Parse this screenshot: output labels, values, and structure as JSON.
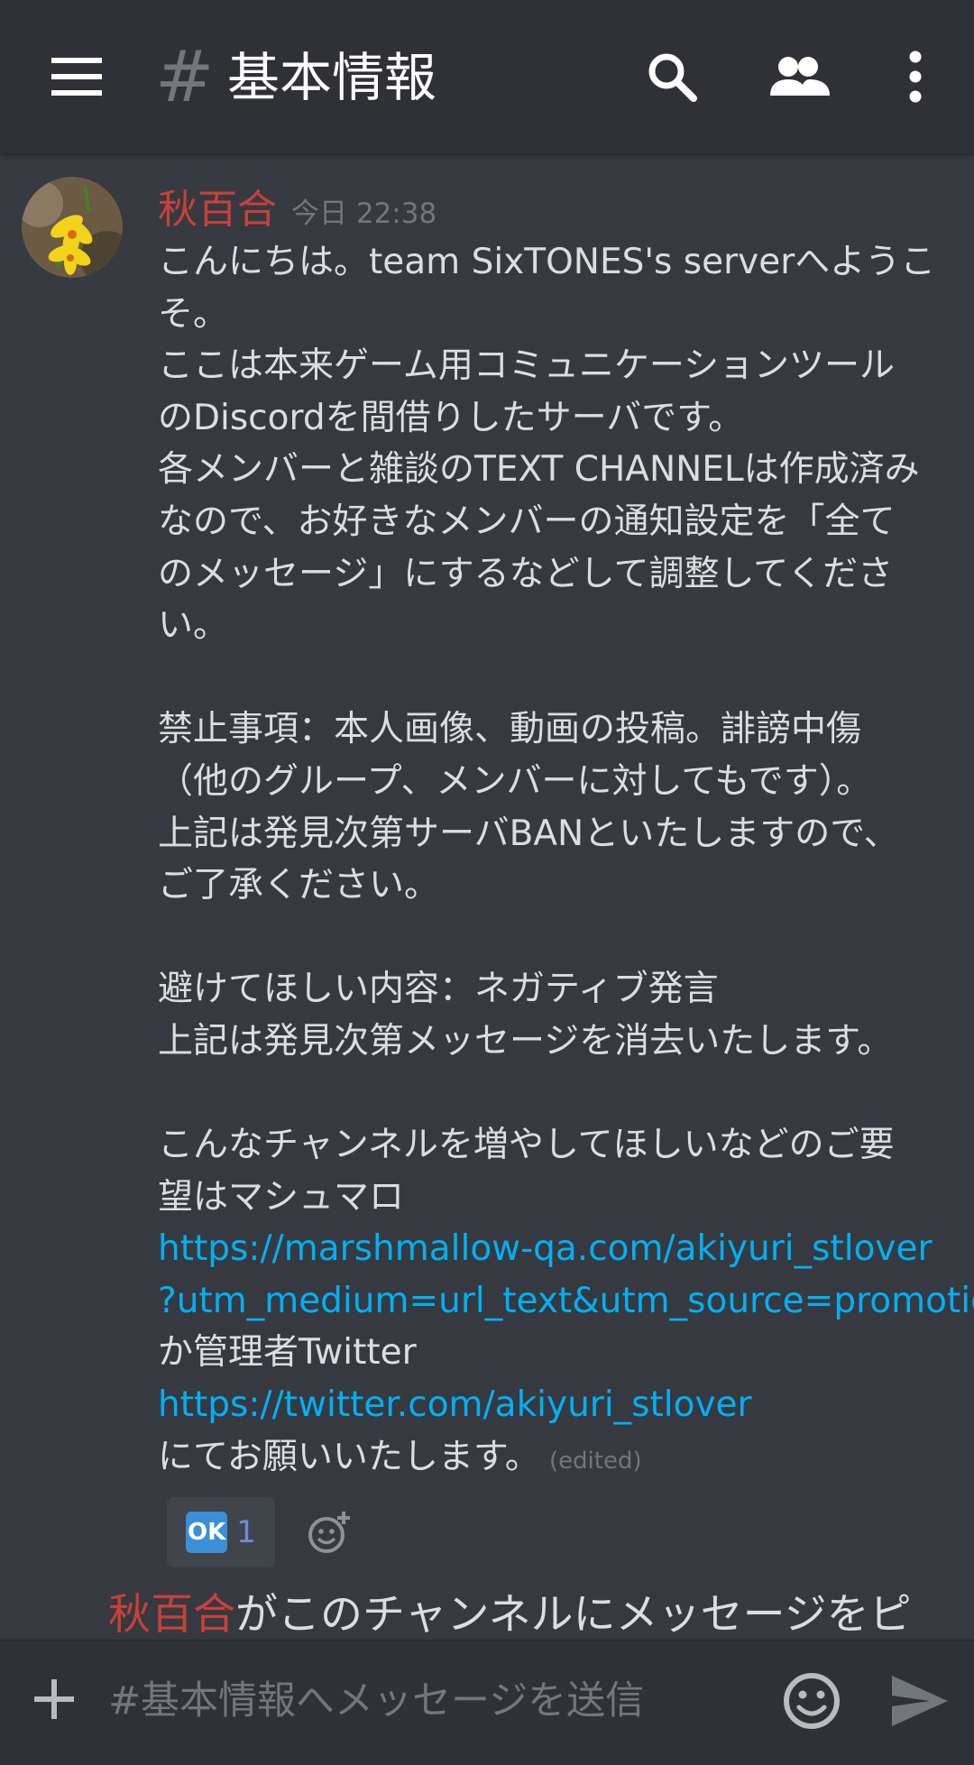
{
  "header": {
    "hash_symbol": "#",
    "channel_name": "基本情報",
    "icons": [
      "hamburger-icon",
      "search-icon",
      "members-icon",
      "more-vertical-icon"
    ]
  },
  "message": {
    "author": "秋百合",
    "timestamp": "今日 22:38",
    "lines": [
      "こんにちは。team SixTONES's serverへようこ",
      "そ。",
      "ここは本来ゲーム用コミュニケーションツール",
      "のDiscordを間借りしたサーバです。",
      "各メンバーと雑談のTEXT CHANNELは作成済み",
      "なので、お好きなメンバーの通知設定を「全て",
      "のメッセージ」にするなどして調整してくださ",
      "い。",
      "",
      "禁止事項：本人画像、動画の投稿。誹謗中傷",
      "（他のグループ、メンバーに対してもです）。",
      "上記は発見次第サーバBANといたしますので、",
      "ご了承ください。",
      "",
      "避けてほしい内容：ネガティブ発言",
      "上記は発見次第メッセージを消去いたします。",
      "",
      "こんなチャンネルを増やしてほしいなどのご要",
      "望はマシュマロ"
    ],
    "link1_line1": "https://marshmallow-qa.com/akiyuri_stlover",
    "link1_line2": "?utm_medium=url_text&utm_source=promotion",
    "after_link1": "か管理者Twitter",
    "link2": "https://twitter.com/akiyuri_stlover",
    "closing": "にてお願いいたします。",
    "edited_label": "(edited)"
  },
  "reactions": [
    {
      "emoji_text": "OK",
      "count": "1"
    }
  ],
  "pin_notice": {
    "author": "秋百合",
    "text": "がこのチャンネルにメッセージをピ"
  },
  "input": {
    "placeholder": "#基本情報へメッセージを送信"
  },
  "colors": {
    "background": "#36393f",
    "header": "#2f3136",
    "author": "#c8403a",
    "link": "#00b0f4",
    "reaction_count": "#7289da"
  }
}
